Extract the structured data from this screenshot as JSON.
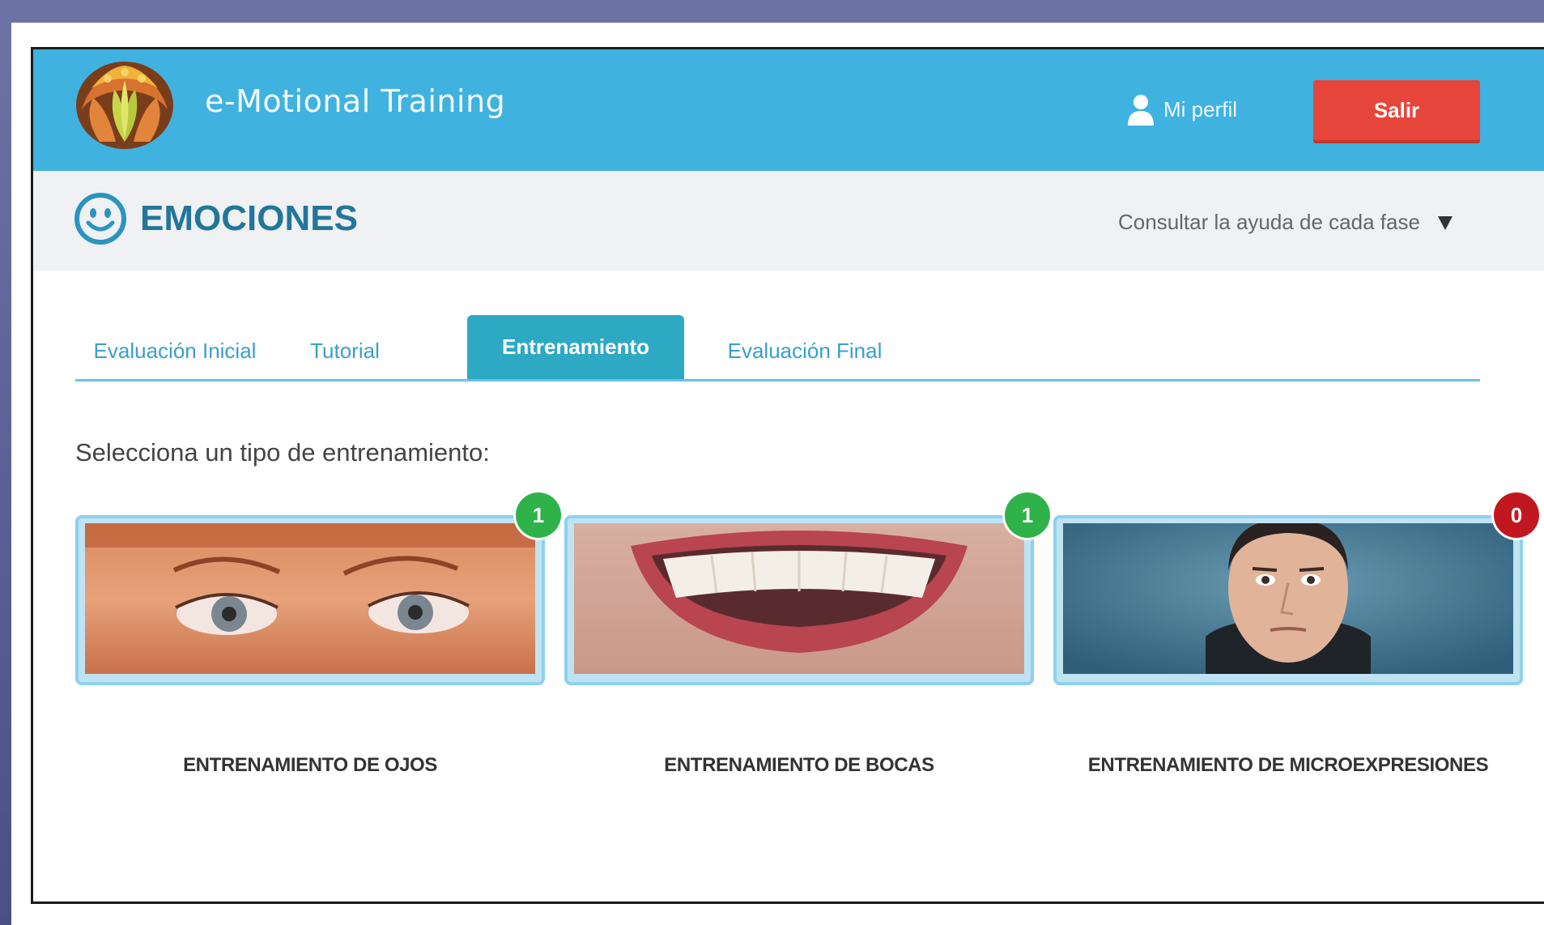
{
  "header": {
    "app_title": "e-Motional Training",
    "profile_label": "Mi perfil",
    "logout_label": "Salir",
    "colors": {
      "bar": "#3fb2e0",
      "logout": "#e5453a"
    }
  },
  "subheader": {
    "section_title": "EMOCIONES",
    "help_label": "Consultar la ayuda de cada fase"
  },
  "tabs": [
    {
      "label": "Evaluación Inicial",
      "active": false
    },
    {
      "label": "Tutorial",
      "active": false
    },
    {
      "label": "Entrenamiento",
      "active": true
    },
    {
      "label": "Evaluación Final",
      "active": false
    }
  ],
  "prompt": "Selecciona un tipo de entrenamiento:",
  "cards": [
    {
      "label": "ENTRENAMIENTO DE OJOS",
      "badge": "1",
      "badge_color": "#2fb24a",
      "image": "eyes"
    },
    {
      "label": "ENTRENAMIENTO DE BOCAS",
      "badge": "1",
      "badge_color": "#2fb24a",
      "image": "smiling-mouth"
    },
    {
      "label": "ENTRENAMIENTO DE MICROEXPRESIONES",
      "badge": "0",
      "badge_color": "#c1181f",
      "image": "man-face"
    }
  ]
}
